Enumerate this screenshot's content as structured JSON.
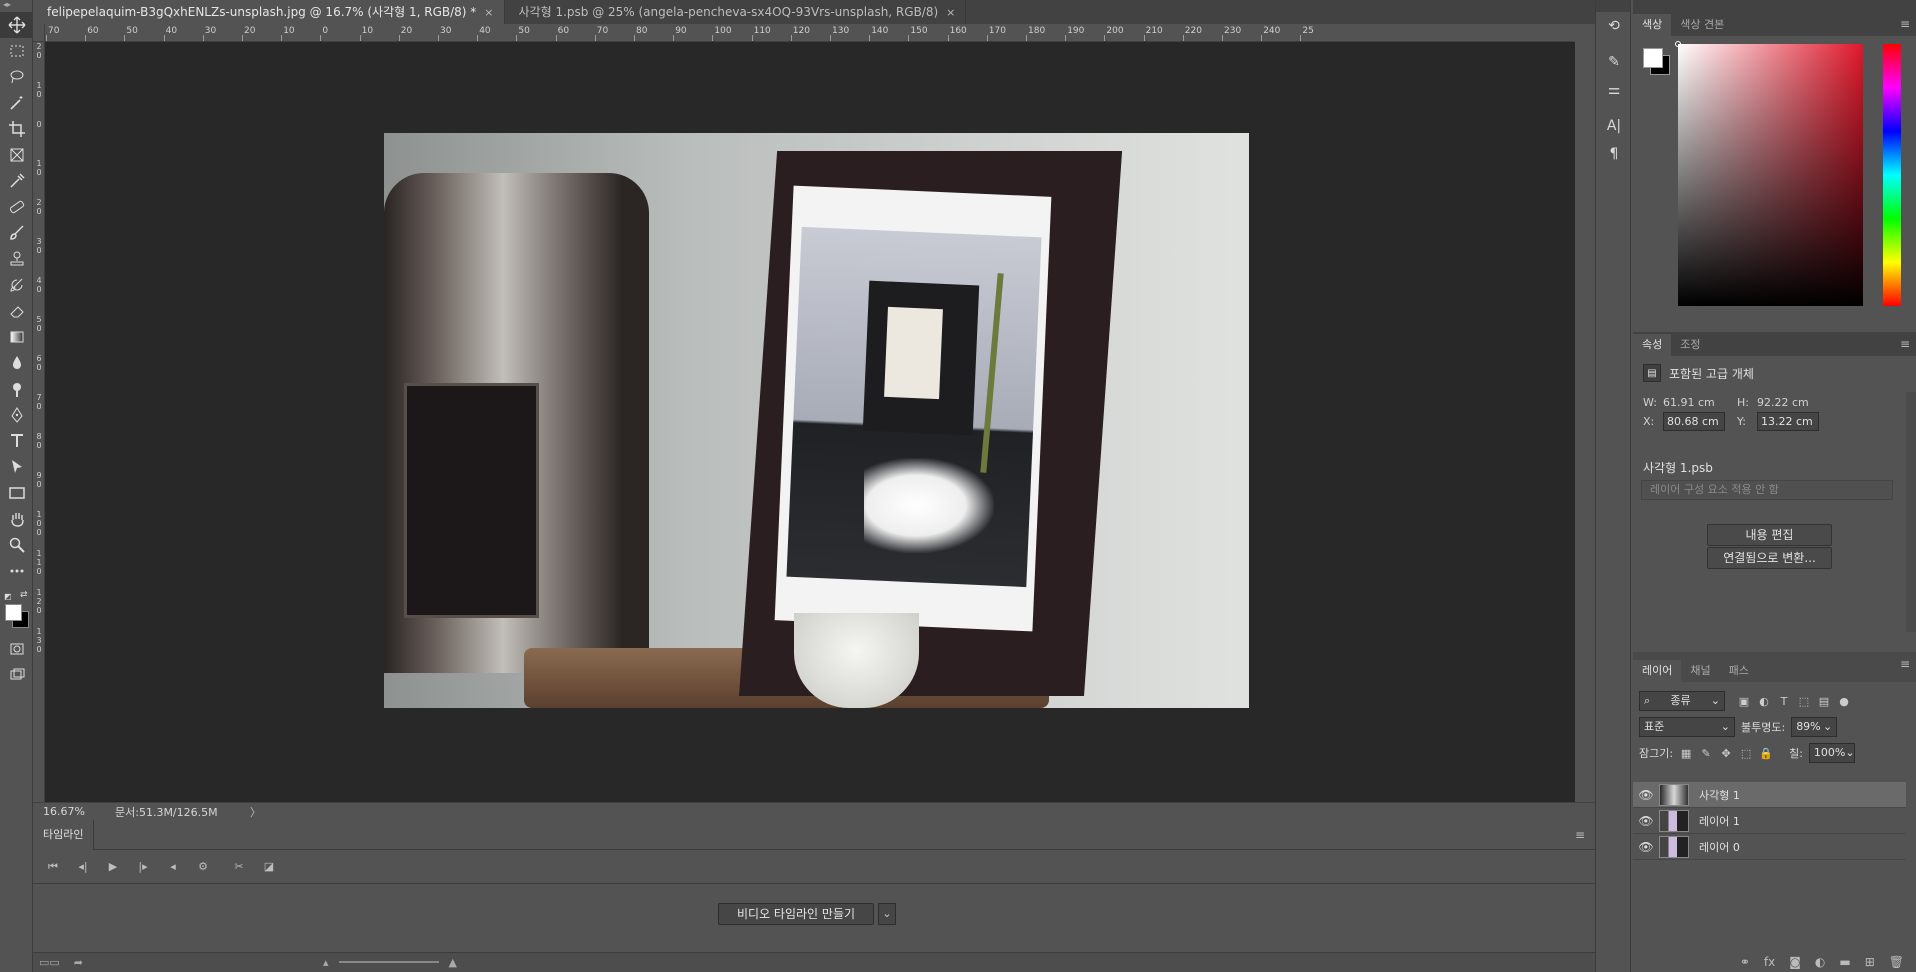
{
  "tabs": [
    {
      "label": "felipepelaquim-B3gQxhENLZs-unsplash.jpg @ 16.7% (사각형 1, RGB/8) *",
      "close": "×"
    },
    {
      "label": "사각형 1.psb @ 25% (angela-pencheva-sx4OQ-93Vrs-unsplash, RGB/8)",
      "close": "×"
    }
  ],
  "ruler_top": [
    "70",
    "60",
    "50",
    "40",
    "30",
    "20",
    "10",
    "0",
    "10",
    "20",
    "30",
    "40",
    "50",
    "60",
    "70",
    "80",
    "90",
    "100",
    "110",
    "120",
    "130",
    "140",
    "150",
    "160",
    "170",
    "180",
    "190",
    "200",
    "210",
    "220",
    "230",
    "240",
    "25"
  ],
  "ruler_left": [
    "2\n0",
    "1\n0",
    "0",
    "1\n0",
    "2\n0",
    "3\n0",
    "4\n0",
    "5\n0",
    "6\n0",
    "7\n0",
    "8\n0",
    "9\n0",
    "1\n0\n0",
    "1\n1\n0",
    "1\n2\n0",
    "1\n3\n0"
  ],
  "status": {
    "zoom": "16.67%",
    "doc": "문서:51.3M/126.5M",
    "arrow": "〉"
  },
  "timeline": {
    "tab": "타임라인",
    "create_button": "비디오 타임라인 만들기",
    "dropdown": "⌄"
  },
  "color_panel": {
    "tabs": [
      "색상",
      "색상 견본"
    ]
  },
  "properties": {
    "tabs": [
      "속성",
      "조정"
    ],
    "type_label": "포함된 고급 개체",
    "w_label": "W:",
    "w_value": "61.91 cm",
    "h_label": "H:",
    "h_value": "92.22 cm",
    "x_label": "X:",
    "x_value": "80.68 cm",
    "y_label": "Y:",
    "y_value": "13.22 cm",
    "smart_name": "사각형 1.psb",
    "comp_placeholder": "레이어 구성 요소 적용 안 함",
    "edit_button": "내용 편집",
    "convert_button": "연결됨으로 변환..."
  },
  "layers_panel": {
    "tabs": [
      "레이어",
      "채널",
      "패스"
    ],
    "filter": "종류",
    "blend_mode": "표준",
    "opacity_label": "불투명도:",
    "opacity_value": "89%",
    "lock_label": "잠그기:",
    "fill_label": "칠:",
    "fill_value": "100%",
    "layers": [
      {
        "name": "사각형 1",
        "selected": true
      },
      {
        "name": "레이어 1",
        "selected": false
      },
      {
        "name": "레이어 0",
        "selected": false
      }
    ]
  },
  "colors": {
    "accent_red": "#e0182b",
    "panel_bg": "#535353",
    "canvas_bg": "#282828"
  }
}
